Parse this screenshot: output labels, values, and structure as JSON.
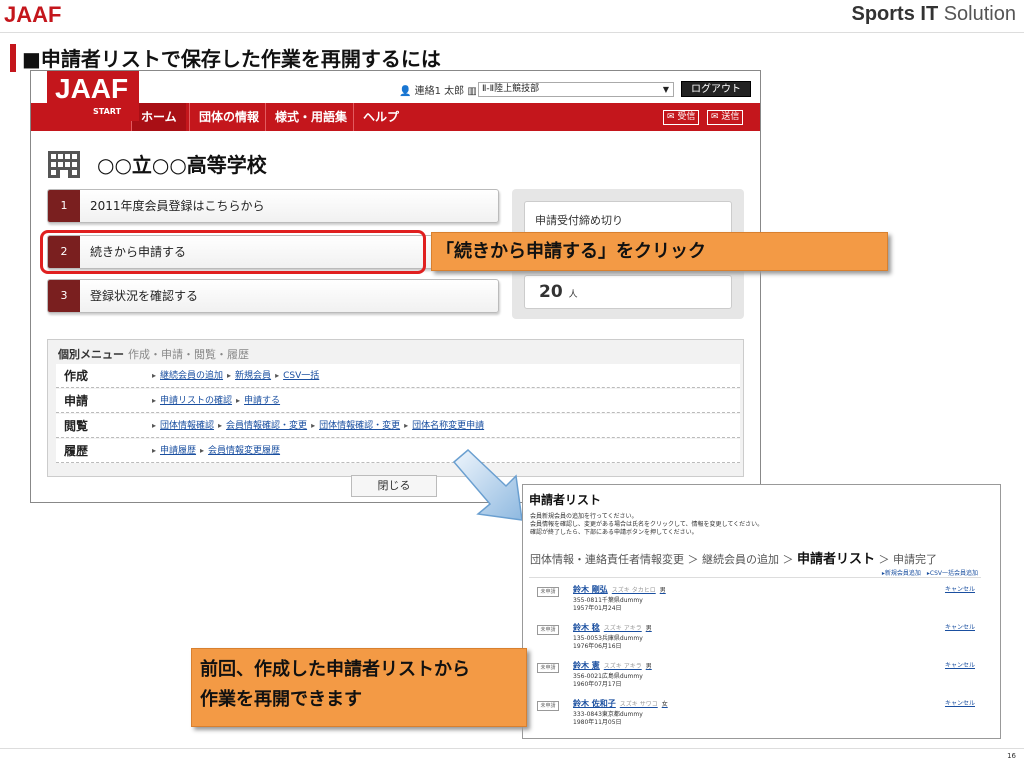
{
  "slide": {
    "logo": "JAAF",
    "brand_bold": "Sports IT",
    "brand_rest": " Solution",
    "title": "■申請者リストで保存した作業を再開するには",
    "page_number": "16"
  },
  "app": {
    "logo": "JAAF",
    "logo_sub": "START",
    "user": "連絡1 太郎",
    "org": "Ⅱ-Ⅱ陸上競技部",
    "logout": "ログアウト",
    "nav": [
      "ホーム",
      "団体の情報",
      "様式・用語集",
      "ヘルプ"
    ],
    "mail_receive": "受信",
    "mail_send": "送信",
    "school_name": "○○立○○高等学校",
    "steps": [
      {
        "num": "1",
        "label": "2011年度会員登録はこちらから"
      },
      {
        "num": "2",
        "label": "続きから申請する"
      },
      {
        "num": "3",
        "label": "登録状況を確認する"
      }
    ],
    "deadline_label": "申請受付締め切り",
    "count": "20",
    "count_unit": "人",
    "menu": {
      "title": "個別メニュー",
      "subtitle": "作成・申請・閲覧・履歴",
      "rows": [
        {
          "head": "作成",
          "links": [
            "継続会員の追加",
            "新規会員",
            "CSV一括"
          ]
        },
        {
          "head": "申請",
          "links": [
            "申請リストの確認",
            "申請する"
          ]
        },
        {
          "head": "閲覧",
          "links": [
            "団体情報確認",
            "会員情報確認・変更",
            "団体情報確認・変更",
            "団体名称変更申請"
          ]
        },
        {
          "head": "履歴",
          "links": [
            "申請履歴",
            "会員情報変更履歴"
          ]
        }
      ]
    },
    "close": "閉じる"
  },
  "callouts": {
    "click": "「続きから申請する」をクリック",
    "resume_line1": "前回、作成した申請者リストから",
    "resume_line2": "作業を再開できます"
  },
  "list": {
    "title": "申請者リスト",
    "notes": [
      "会員新規会員の追加を行ってください。",
      "会員情報を確認し、変更がある場合は氏名をクリックして、情報を変更してください。",
      "確認が終了したら、下部にある申請ボタンを押してください。"
    ],
    "crumb1": "団体情報・連絡責任者情報変更 ＞ 継続会員の追加 ＞ ",
    "crumb_current": "申請者リスト",
    "crumb2": " ＞ 申請完了",
    "links": "▸新規会員追加　▸CSV一括会員追加",
    "status_tag": "未申請",
    "cancel": "キャンセル",
    "rows": [
      {
        "name": "鈴木 剛弘",
        "kana": "スズキ タカヒロ",
        "sex": "男",
        "addr": "355-0811千葉県dummy",
        "dob": "1957年01月24日"
      },
      {
        "name": "鈴木 稔",
        "kana": "スズキ アキラ",
        "sex": "男",
        "addr": "135-0053兵庫県dummy",
        "dob": "1976年06月16日"
      },
      {
        "name": "鈴木 憲",
        "kana": "スズキ アキラ",
        "sex": "男",
        "addr": "356-0021広島県dummy",
        "dob": "1960年07月17日"
      },
      {
        "name": "鈴木 佐和子",
        "kana": "スズキ サワコ",
        "sex": "女",
        "addr": "333-0843東京都dummy",
        "dob": "1980年11月05日"
      }
    ]
  }
}
